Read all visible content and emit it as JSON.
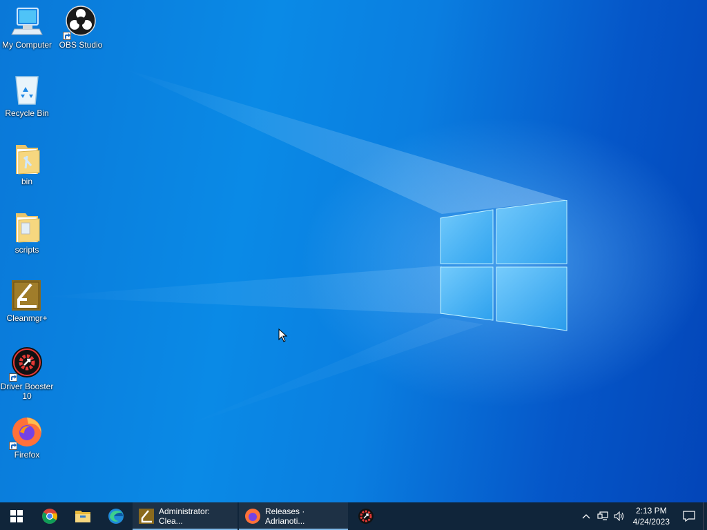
{
  "desktop": {
    "icons": [
      {
        "label": "My Computer",
        "icon": "computer-icon"
      },
      {
        "label": "OBS Studio",
        "icon": "obs-icon"
      },
      {
        "label": "Recycle Bin",
        "icon": "recycle-bin-icon"
      },
      {
        "label": "bin",
        "icon": "folder-icon"
      },
      {
        "label": "scripts",
        "icon": "folder-icon"
      },
      {
        "label": "Cleanmgr+",
        "icon": "cleanmgr-icon"
      },
      {
        "label": "Driver Booster 10",
        "icon": "driver-booster-icon"
      },
      {
        "label": "Firefox",
        "icon": "firefox-icon"
      }
    ]
  },
  "taskbar": {
    "start_icon": "windows-start-icon",
    "pinned": [
      {
        "icon": "chrome-icon"
      },
      {
        "icon": "file-explorer-icon"
      },
      {
        "icon": "edge-icon"
      }
    ],
    "apps": [
      {
        "label": "Administrator: Clea...",
        "icon": "cleanmgr-icon"
      },
      {
        "label": "Releases · Adrianoti...",
        "icon": "firefox-icon"
      },
      {
        "label": "",
        "icon": "driver-booster-icon"
      }
    ],
    "tray": {
      "icons": [
        "chevron-up-icon",
        "network-icon",
        "volume-icon"
      ],
      "time": "2:13 PM",
      "date": "4/24/2023",
      "notification_icon": "action-center-icon"
    }
  },
  "colors": {
    "taskbar": "#10253a",
    "accent": "#0a78d8"
  }
}
